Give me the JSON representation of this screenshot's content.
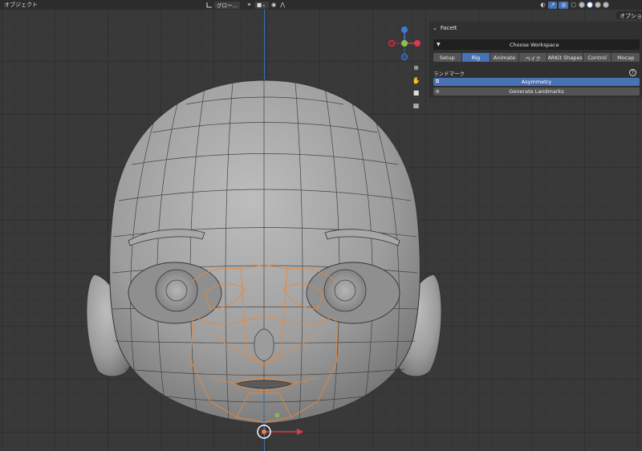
{
  "header": {
    "mode_label": "オブジェクト",
    "transform_orientation": "グロー...",
    "chevron": "⌄"
  },
  "options_tab": "オプション",
  "facelt_panel": {
    "title": "FaceIt",
    "workspace_button": "Choose Workspace",
    "tabs": [
      {
        "label": "Setup",
        "active": false
      },
      {
        "label": "Rig",
        "active": true
      },
      {
        "label": "Animate",
        "active": false
      },
      {
        "label": "ベイク",
        "active": false
      },
      {
        "label": "ARKit Shapes",
        "active": false
      },
      {
        "label": "Control",
        "active": false
      },
      {
        "label": "Mocap",
        "active": false
      }
    ],
    "section_label": "ランドマーク",
    "help_glyph": "?",
    "asymmetry_button": "Asymmetry",
    "generate_landmarks_button": "Generate Landmarks"
  },
  "gizmo": {
    "axes": [
      "Z",
      "X",
      "Y"
    ],
    "colors": {
      "x": "#e0384c",
      "y": "#8bc34a",
      "z": "#3d7bd9"
    }
  },
  "colors": {
    "accent": "#4772b3",
    "landmark": "#e8883a",
    "viewport_bg": "#393939"
  }
}
